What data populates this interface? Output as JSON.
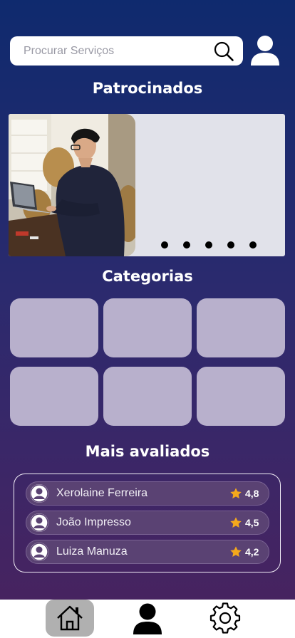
{
  "search": {
    "placeholder": "Procurar Serviços",
    "icon": "search-icon"
  },
  "header": {
    "profile_icon": "user-icon"
  },
  "sponsored": {
    "title": "Patrocinados",
    "slide_count": 5
  },
  "categories": {
    "title": "Categorias",
    "items": [
      "",
      "",
      "",
      "",
      "",
      ""
    ]
  },
  "top_rated": {
    "title": "Mais avaliados",
    "items": [
      {
        "name": "Xerolaine Ferreira",
        "rating": "4,8"
      },
      {
        "name": "João Impresso",
        "rating": "4,5"
      },
      {
        "name": "Luiza Manuza",
        "rating": "4,2"
      }
    ]
  },
  "nav": {
    "items": [
      {
        "icon": "home-icon",
        "active": true
      },
      {
        "icon": "user-icon",
        "active": false
      },
      {
        "icon": "gear-icon",
        "active": false
      }
    ]
  },
  "colors": {
    "star": "#f4a81c",
    "category_tile": "#b8b0cc",
    "banner_bg": "#e1e2ea"
  }
}
